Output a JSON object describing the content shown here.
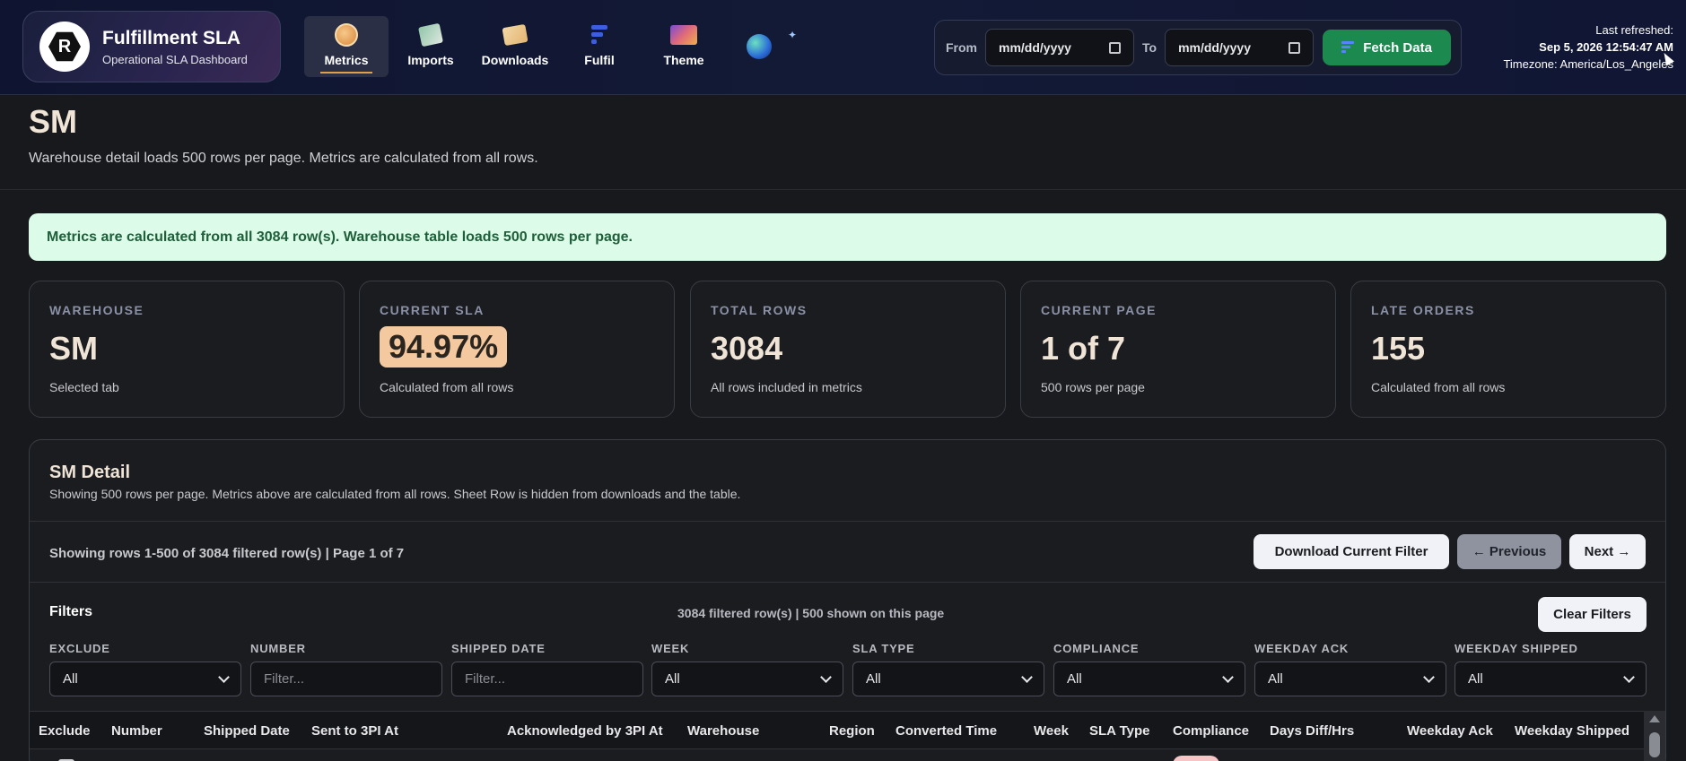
{
  "brand": {
    "title": "Fulfillment SLA",
    "subtitle": "Operational SLA Dashboard",
    "logo_letter": "R"
  },
  "nav": [
    {
      "label": "Metrics",
      "icon": "metrics-coin-icon",
      "active": true
    },
    {
      "label": "Imports",
      "icon": "imports-icon"
    },
    {
      "label": "Downloads",
      "icon": "downloads-icon"
    },
    {
      "label": "Fulfil",
      "icon": "fulfil-logo-icon"
    },
    {
      "label": "Theme",
      "icon": "theme-icon"
    }
  ],
  "range": {
    "from_label": "From",
    "to_label": "To",
    "from_value": "mm/dd/yyyy",
    "to_value": "mm/dd/yyyy",
    "fetch_label": "Fetch Data"
  },
  "refresh": {
    "label": "Last refreshed:",
    "time": "Sep 5, 2026 12:54:47 AM",
    "timezone": "Timezone: America/Los_Angeles"
  },
  "page": {
    "title": "SM",
    "subtitle": "Warehouse detail loads 500 rows per page. Metrics are calculated from all rows."
  },
  "notice": "Metrics are calculated from all 3084 row(s). Warehouse table loads 500 rows per page.",
  "cards": [
    {
      "label": "WAREHOUSE",
      "value": "SM",
      "foot": "Selected tab"
    },
    {
      "label": "CURRENT SLA",
      "value": "94.97%",
      "foot": "Calculated from all rows"
    },
    {
      "label": "TOTAL ROWS",
      "value": "3084",
      "foot": "All rows included in metrics"
    },
    {
      "label": "CURRENT PAGE",
      "value": "1 of 7",
      "foot": "500 rows per page"
    },
    {
      "label": "LATE ORDERS",
      "value": "155",
      "foot": "Calculated from all rows"
    }
  ],
  "detail": {
    "title": "SM Detail",
    "subtitle": "Showing 500 rows per page. Metrics above are calculated from all rows. Sheet Row is hidden from downloads and the table.",
    "showing": "Showing rows 1-500 of 3084 filtered row(s) | Page 1 of 7",
    "download_label": "Download Current Filter",
    "prev_label": "← Previous",
    "next_label": "Next →"
  },
  "filters": {
    "title": "Filters",
    "count": "3084 filtered row(s) | 500 shown on this page",
    "clear_label": "Clear Filters",
    "fields": [
      {
        "label": "EXCLUDE",
        "type": "select",
        "value": "All"
      },
      {
        "label": "NUMBER",
        "type": "input",
        "placeholder": "Filter..."
      },
      {
        "label": "SHIPPED DATE",
        "type": "input",
        "placeholder": "Filter..."
      },
      {
        "label": "WEEK",
        "type": "select",
        "value": "All"
      },
      {
        "label": "SLA TYPE",
        "type": "select",
        "value": "All"
      },
      {
        "label": "COMPLIANCE",
        "type": "select",
        "value": "All"
      },
      {
        "label": "WEEKDAY ACK",
        "type": "select",
        "value": "All"
      },
      {
        "label": "WEEKDAY SHIPPED",
        "type": "select",
        "value": "All"
      }
    ]
  },
  "table": {
    "columns": [
      "Exclude",
      "Number",
      "Shipped Date",
      "Sent to 3PI At",
      "Acknowledged by 3PI At",
      "Warehouse",
      "Region",
      "Converted Time",
      "Week",
      "SLA Type",
      "Compliance",
      "Days Diff/Hrs",
      "Weekday Ack",
      "Weekday Shipped"
    ]
  }
}
